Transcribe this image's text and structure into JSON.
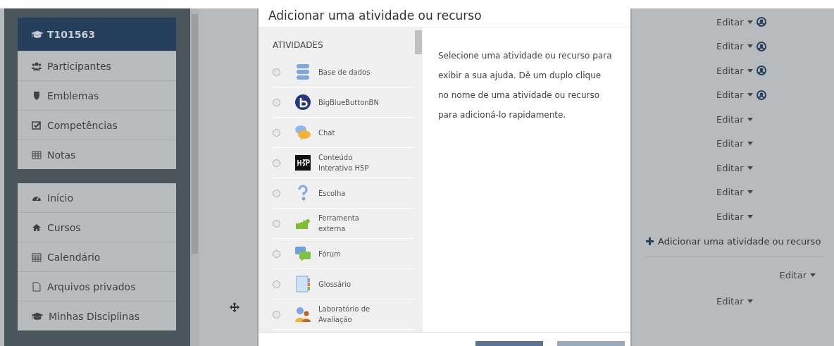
{
  "sidebar": {
    "course": "T101563",
    "course_items": [
      {
        "label": "Participantes"
      },
      {
        "label": "Emblemas"
      },
      {
        "label": "Competências"
      },
      {
        "label": "Notas"
      }
    ],
    "site_items": [
      {
        "label": "Início"
      },
      {
        "label": "Cursos"
      },
      {
        "label": "Calendário"
      },
      {
        "label": "Arquivos privados"
      },
      {
        "label": "Minhas Disciplinas"
      }
    ]
  },
  "modal": {
    "title": "Adicionar uma atividade ou recurso",
    "section": "ATIVIDADES",
    "activities": [
      {
        "label": "Base de dados",
        "selected": false
      },
      {
        "label": "BigBlueButtonBN",
        "selected": false
      },
      {
        "label": "Chat",
        "selected": false
      },
      {
        "label": "Conteúdo Interativo H5P",
        "selected": false
      },
      {
        "label": "Escolha",
        "selected": false
      },
      {
        "label": "Ferramenta externa",
        "selected": false
      },
      {
        "label": "Fórum",
        "selected": false
      },
      {
        "label": "Glossário",
        "selected": false
      },
      {
        "label": "Laboratório de Avaliação",
        "selected": false
      }
    ],
    "help": "Selecione uma atividade ou recurso para exibir a sua ajuda. Dê um duplo clique no nome de uma atividade ou recurso para adicioná-lo rapidamente."
  },
  "course_content": {
    "edit_items": [
      {
        "label": "Editar",
        "role_icon": true
      },
      {
        "label": "Editar",
        "role_icon": true
      },
      {
        "label": "Editar",
        "role_icon": true
      },
      {
        "label": "Editar",
        "role_icon": true
      },
      {
        "label": "Editar",
        "role_icon": false
      },
      {
        "label": "Editar",
        "role_icon": false
      },
      {
        "label": "Editar",
        "role_icon": false
      },
      {
        "label": "Editar",
        "role_icon": false
      },
      {
        "label": "Editar",
        "role_icon": false
      }
    ],
    "add_link": "Adicionar uma atividade ou recurso",
    "section_edit": "Editar",
    "next_edit": "Editar"
  }
}
